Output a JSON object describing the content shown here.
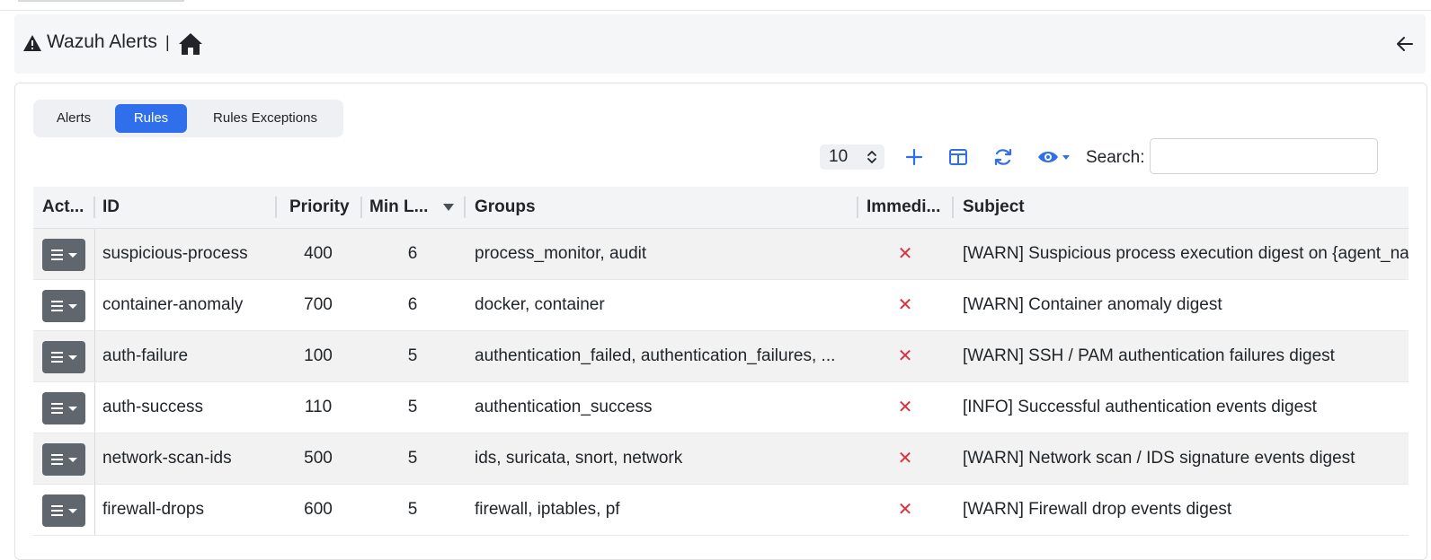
{
  "header": {
    "title": "Wazuh Alerts",
    "separator": "|",
    "warn_icon": "warning-triangle-icon",
    "home_icon": "home-icon",
    "back_icon": "arrow-left-icon"
  },
  "tabs": [
    {
      "label": "Alerts",
      "active": false
    },
    {
      "label": "Rules",
      "active": true
    },
    {
      "label": "Rules Exceptions",
      "active": false
    }
  ],
  "toolbar": {
    "page_length": "10",
    "search_label": "Search:",
    "search_value": "",
    "icons": [
      "plus-icon",
      "columns-icon",
      "refresh-icon",
      "eye-icon"
    ]
  },
  "table": {
    "columns": [
      "Act...",
      "ID",
      "Priority",
      "Min L...",
      "Groups",
      "Immedi...",
      "Subject"
    ],
    "sorted_column": "Min L...",
    "sort_direction": "descending",
    "rows": [
      {
        "id": "suspicious-process",
        "priority": "400",
        "min_level": "6",
        "groups": "process_monitor, audit",
        "immediate": "✕",
        "subject": "[WARN] Suspicious process execution digest on {agent_name}"
      },
      {
        "id": "container-anomaly",
        "priority": "700",
        "min_level": "6",
        "groups": "docker, container",
        "immediate": "✕",
        "subject": "[WARN] Container anomaly digest"
      },
      {
        "id": "auth-failure",
        "priority": "100",
        "min_level": "5",
        "groups": "authentication_failed, authentication_failures, ...",
        "immediate": "✕",
        "subject": "[WARN] SSH / PAM authentication failures digest"
      },
      {
        "id": "auth-success",
        "priority": "110",
        "min_level": "5",
        "groups": "authentication_success",
        "immediate": "✕",
        "subject": "[INFO] Successful authentication events digest"
      },
      {
        "id": "network-scan-ids",
        "priority": "500",
        "min_level": "5",
        "groups": "ids, suricata, snort, network",
        "immediate": "✕",
        "subject": "[WARN] Network scan / IDS signature events digest"
      },
      {
        "id": "firewall-drops",
        "priority": "600",
        "min_level": "5",
        "groups": "firewall, iptables, pf",
        "immediate": "✕",
        "subject": "[WARN] Firewall drop events digest"
      }
    ]
  },
  "colors": {
    "accent": "#2f6fec",
    "action_button": "#60666d",
    "false_mark": "#d9333f",
    "header_bg": "#f5f6f8"
  }
}
